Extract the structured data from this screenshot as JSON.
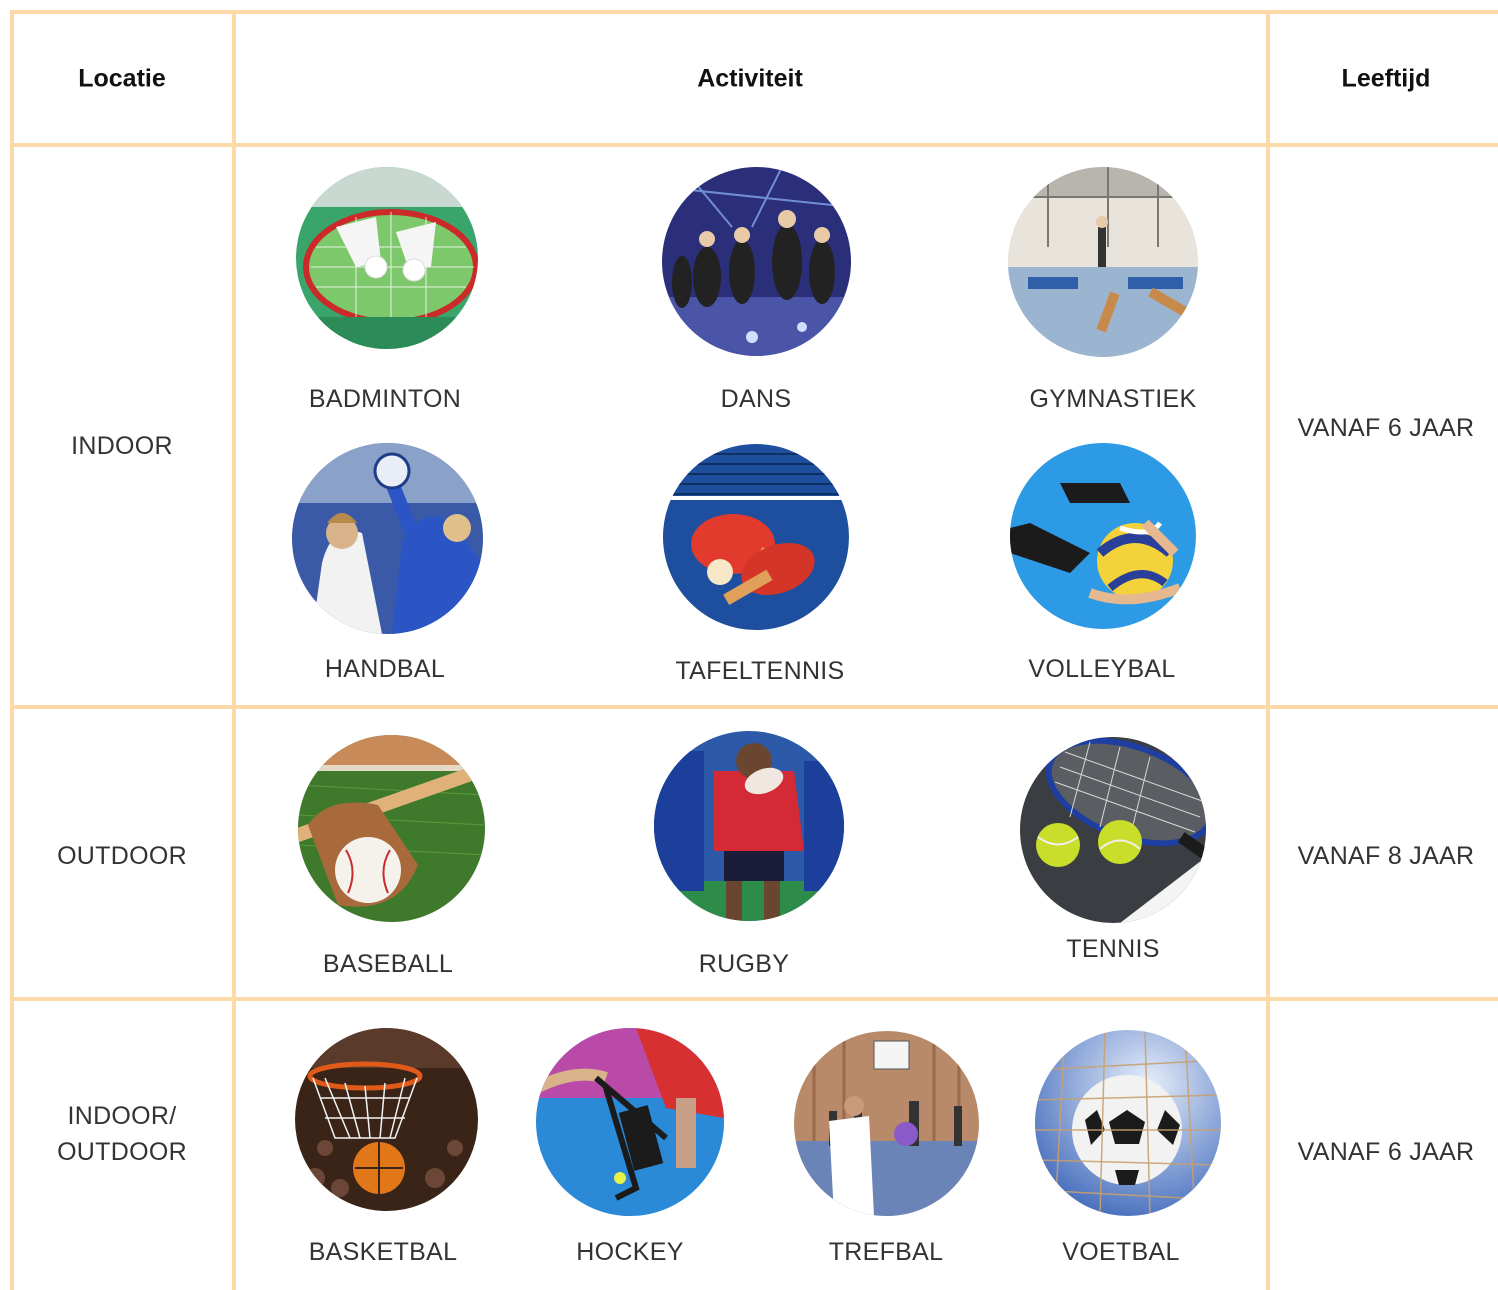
{
  "headers": {
    "location": "Locatie",
    "activity": "Activiteit",
    "age": "Leeftijd"
  },
  "rows": [
    {
      "location": "INDOOR",
      "age": "VANAF 6 JAAR",
      "activities": [
        {
          "label": "BADMINTON",
          "icon": "badminton-photo"
        },
        {
          "label": "DANS",
          "icon": "dance-photo"
        },
        {
          "label": "GYMNASTIEK",
          "icon": "gymnastics-photo"
        },
        {
          "label": "HANDBAL",
          "icon": "handball-photo"
        },
        {
          "label": "TAFELTENNIS",
          "icon": "table-tennis-photo"
        },
        {
          "label": "VOLLEYBAL",
          "icon": "volleyball-photo"
        }
      ]
    },
    {
      "location": "OUTDOOR",
      "age": "VANAF 8 JAAR",
      "activities": [
        {
          "label": "BASEBALL",
          "icon": "baseball-photo"
        },
        {
          "label": "RUGBY",
          "icon": "rugby-photo"
        },
        {
          "label": "TENNIS",
          "icon": "tennis-photo"
        }
      ]
    },
    {
      "location_line1": "INDOOR/",
      "location_line2": "OUTDOOR",
      "age": "VANAF 6 JAAR",
      "activities": [
        {
          "label": "BASKETBAL",
          "icon": "basketball-photo"
        },
        {
          "label": "HOCKEY",
          "icon": "hockey-photo"
        },
        {
          "label": "TREFBAL",
          "icon": "dodgeball-photo"
        },
        {
          "label": "VOETBAL",
          "icon": "football-photo"
        }
      ]
    }
  ],
  "colors": {
    "border": "#fcd9a6"
  }
}
